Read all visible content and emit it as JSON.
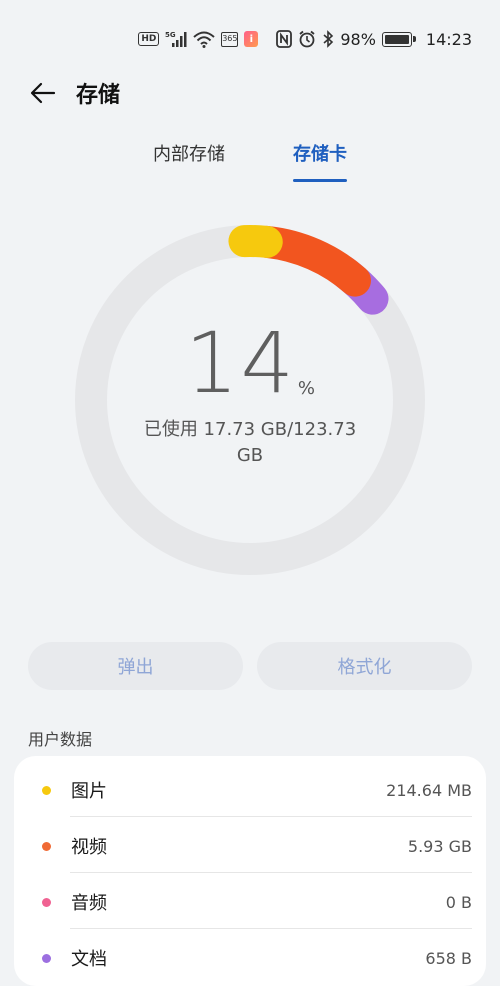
{
  "status_bar": {
    "hd_badge": "HD",
    "network": "5G",
    "calendar_badge": "365",
    "app_badge": "i",
    "battery_percent": "98%",
    "battery_level": 0.98,
    "time": "14:23",
    "icons": [
      "hd-icon",
      "signal-5g-icon",
      "wifi-icon",
      "calendar-icon",
      "app-notification-icon",
      "nfc-icon",
      "alarm-icon",
      "bluetooth-icon",
      "battery-icon"
    ]
  },
  "header": {
    "back_icon": "back-arrow-icon",
    "title": "存储"
  },
  "tabs": [
    {
      "label": "内部存储",
      "active": false
    },
    {
      "label": "存储卡",
      "active": true
    }
  ],
  "gauge": {
    "percent": "14",
    "percent_unit": "%",
    "used_text": "已使用 17.73 GB/123.73 GB",
    "used_fraction": 0.14,
    "segment_colors": [
      "#f6c90e",
      "#f2551f",
      "#a76de0"
    ]
  },
  "actions": {
    "eject_label": "弹出",
    "format_label": "格式化"
  },
  "user_data": {
    "section_label": "用户数据",
    "items": [
      {
        "name": "图片",
        "size": "214.64 MB",
        "color": "#f6c90e"
      },
      {
        "name": "视频",
        "size": "5.93 GB",
        "color": "#f06a35"
      },
      {
        "name": "音频",
        "size": "0 B",
        "color": "#f06292"
      },
      {
        "name": "文档",
        "size": "658 B",
        "color": "#9c6fe0"
      }
    ]
  },
  "colors": {
    "accent": "#1f5fbf",
    "background": "#f1f3f5",
    "ring_track": "#e6e7e9"
  }
}
